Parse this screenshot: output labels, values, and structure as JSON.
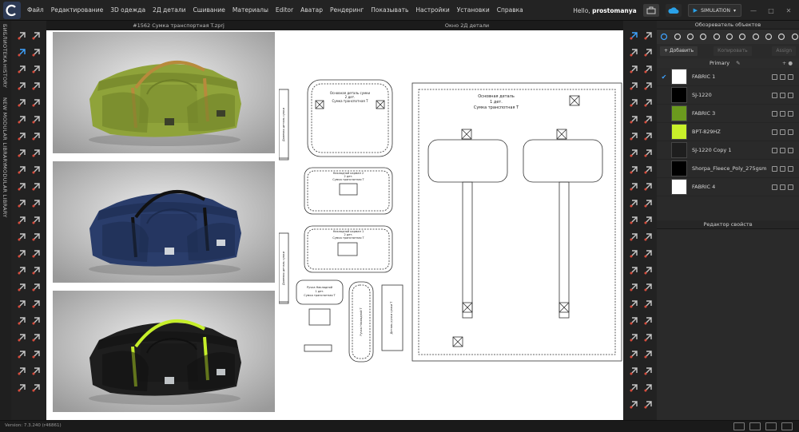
{
  "menubar": {
    "items": [
      "Файл",
      "Редактирование",
      "3D одежда",
      "2Д детали",
      "Сшивание",
      "Материалы",
      "Editor",
      "Аватар",
      "Рендеринг",
      "Показывать",
      "Настройки",
      "Установки",
      "Справка"
    ],
    "greeting": "Hello,",
    "username": "prostomanya",
    "simulation_label": "SIMULATION"
  },
  "side_tabs": [
    "БИБЛИОТЕКА",
    "HISTORY",
    "NEW MODULAR LIBRARY",
    "MODULAR LIBRARY"
  ],
  "viewports": {
    "view3d_title": "#1562 Сумка транспортная T.zprj",
    "view2d_title": "Окно 2Д детали"
  },
  "renders": [
    {
      "name": "green",
      "body": "#8fa33a",
      "body_dark": "#6e7f27",
      "strap": "#b88a3c",
      "label": "#3b3f2a"
    },
    {
      "name": "navy",
      "body": "#2a3d6b",
      "body_dark": "#1c2b4f",
      "strap": "#111111",
      "label": "#cfd4da"
    },
    {
      "name": "black",
      "body": "#1e1e1e",
      "body_dark": "#101010",
      "strap": "#c6ef2a",
      "label": "#bfc3c6"
    }
  ],
  "pattern": {
    "main_piece": {
      "line1": "Основная деталь",
      "line2": "1 дет.",
      "line3": "Сумка транспотная T"
    },
    "bottom_piece": {
      "line1": "Основная деталь сумки",
      "line2": "2 дет.",
      "line3": "Сумка транспотная T"
    },
    "pocket_piece_1": {
      "line1": "Накладной карман 2",
      "line2": "2 дет.",
      "line3": "Сумка транспотная T"
    },
    "pocket_piece_2": {
      "line1": "Накладной карман 1",
      "line2": "2 дет.",
      "line3": "Сумка транспотная T"
    },
    "small_piece": {
      "line1": "Ручка Накладной",
      "line2": "1 дет.",
      "line3": "Сумка транспотная T"
    },
    "strip_left": "Долевая деталь сумки",
    "strip_bottom": "Долевая деталь сумки",
    "vertical_piece_1": "Ручка Накладной Т",
    "vertical_piece_2": "Деталь ручки сумки Т"
  },
  "object_browser": {
    "title": "Обозреватель объектов",
    "add_label": "Добавить",
    "copy_label": "Копировать",
    "assign_label": "Assign",
    "group_label": "Primary",
    "fabrics": [
      {
        "name": "FABRIC 1",
        "color": "#ffffff",
        "checked": "✔"
      },
      {
        "name": "SJ-1220",
        "color": "#000000",
        "checked": ""
      },
      {
        "name": "FABRIC 3",
        "color": "#6b9a1e",
        "checked": ""
      },
      {
        "name": "BPT-829HZ",
        "color": "#c8f02a",
        "checked": ""
      },
      {
        "name": "SJ-1220 Copy 1",
        "color": "#1e1e1e",
        "checked": ""
      },
      {
        "name": "Shorpa_Fleece_Poly_275gsm",
        "color": "#000000",
        "checked": ""
      },
      {
        "name": "FABRIC 4",
        "color": "#ffffff",
        "checked": ""
      }
    ]
  },
  "property_editor": {
    "title": "Редактор свойств"
  },
  "status": {
    "version": "Version: 7.3.240 (r46861)"
  }
}
